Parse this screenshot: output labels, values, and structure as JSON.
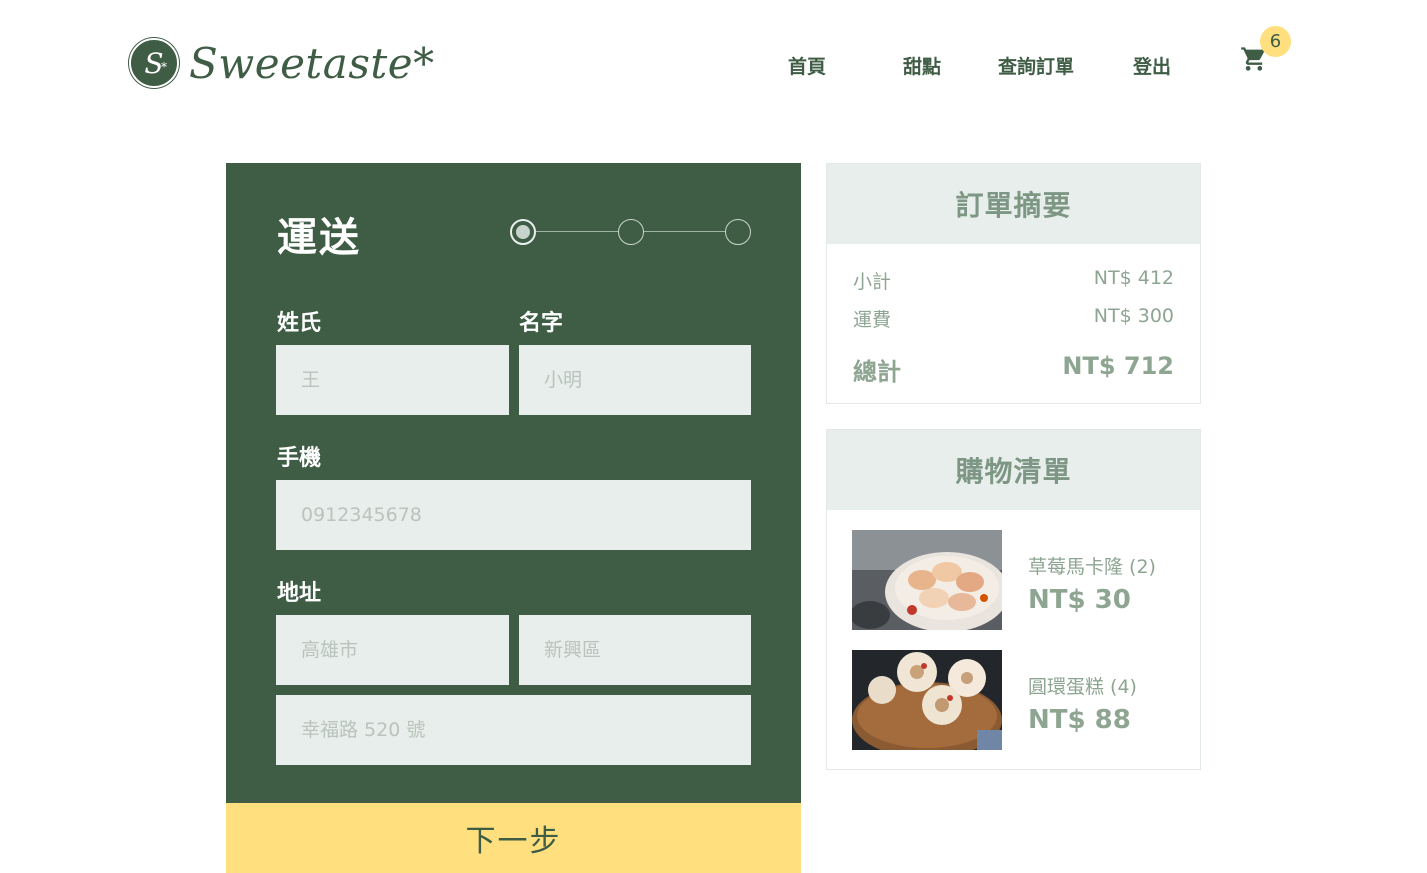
{
  "brand": {
    "logo_letter": "S",
    "logo_star": "*",
    "name": "Sweetaste*"
  },
  "nav": {
    "items": [
      "首頁",
      "甜點",
      "查詢訂單",
      "登出"
    ],
    "cart_count": "6"
  },
  "form": {
    "title": "運送",
    "steps": 3,
    "active_step": 1,
    "last_name_label": "姓氏",
    "first_name_label": "名字",
    "last_name_placeholder": "王",
    "first_name_placeholder": "小明",
    "phone_label": "手機",
    "phone_placeholder": "0912345678",
    "address_label": "地址",
    "city_placeholder": "高雄市",
    "district_placeholder": "新興區",
    "street_placeholder": "幸福路 520 號",
    "next_label": "下一步"
  },
  "summary": {
    "title": "訂單摘要",
    "subtotal_label": "小計",
    "subtotal_value": "NT$ 412",
    "shipping_label": "運費",
    "shipping_value": "NT$ 300",
    "total_label": "總計",
    "total_value": "NT$ 712"
  },
  "cart_list": {
    "title": "購物清單",
    "items": [
      {
        "name": "草莓馬卡隆 (2)",
        "price": "NT$ 30"
      },
      {
        "name": "圓環蛋糕 (4)",
        "price": "NT$ 88"
      }
    ]
  },
  "colors": {
    "primary": "#3f5c45",
    "accent": "#ffdf7e",
    "light": "#e8eeeb",
    "muted": "#8ea592"
  }
}
